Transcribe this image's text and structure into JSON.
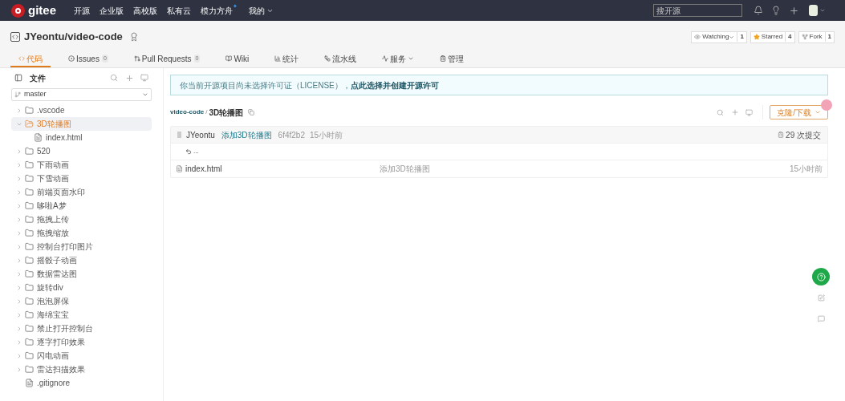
{
  "nav": {
    "logo": "gitee",
    "links": [
      {
        "label": "开源"
      },
      {
        "label": "企业版"
      },
      {
        "label": "高校版"
      },
      {
        "label": "私有云"
      },
      {
        "label": "模力方舟",
        "mark": "✦"
      }
    ],
    "mine": "我的",
    "search": {
      "placeholder": "搜开源"
    }
  },
  "repo": {
    "title": "JYeontu/video-code",
    "actions": [
      {
        "kind": "watch",
        "label": "Watching",
        "count": "1"
      },
      {
        "kind": "star",
        "label": "Starred",
        "count": "4"
      },
      {
        "kind": "fork",
        "label": "Fork",
        "count": "1"
      }
    ]
  },
  "tabs": [
    {
      "kind": "code",
      "label": "代码",
      "selected": true
    },
    {
      "kind": "issues",
      "label": "Issues",
      "count": "0",
      "selected": false
    },
    {
      "kind": "pr",
      "label": "Pull Requests",
      "count": "0",
      "selected": false
    },
    {
      "kind": "wiki",
      "label": "Wiki",
      "selected": false
    },
    {
      "kind": "stats",
      "label": "统计",
      "selected": false
    },
    {
      "kind": "pipeline",
      "label": "流水线",
      "selected": false
    },
    {
      "kind": "service",
      "label": "服务",
      "selected": false
    },
    {
      "kind": "manage",
      "label": "管理",
      "selected": false
    }
  ],
  "sidebar": {
    "title": "文件",
    "branch": "master",
    "tree": [
      {
        "kind": "folder",
        "name": ".vscode",
        "expanded": false,
        "selected": false
      },
      {
        "kind": "folder",
        "name": "3D轮播图",
        "expanded": true,
        "selected": true,
        "children": [
          {
            "kind": "file",
            "name": "index.html",
            "selected": false
          }
        ]
      },
      {
        "kind": "folder",
        "name": "520",
        "expanded": false,
        "selected": false
      },
      {
        "kind": "folder",
        "name": "下雨动画",
        "expanded": false,
        "selected": false
      },
      {
        "kind": "folder",
        "name": "下雪动画",
        "expanded": false,
        "selected": false
      },
      {
        "kind": "folder",
        "name": "前端页面水印",
        "expanded": false,
        "selected": false
      },
      {
        "kind": "folder",
        "name": "哆啦A梦",
        "expanded": false,
        "selected": false
      },
      {
        "kind": "folder",
        "name": "拖拽上传",
        "expanded": false,
        "selected": false
      },
      {
        "kind": "folder",
        "name": "拖拽缩放",
        "expanded": false,
        "selected": false
      },
      {
        "kind": "folder",
        "name": "控制台打印图片",
        "expanded": false,
        "selected": false
      },
      {
        "kind": "folder",
        "name": "摇骰子动画",
        "expanded": false,
        "selected": false
      },
      {
        "kind": "folder",
        "name": "数据雷达图",
        "expanded": false,
        "selected": false
      },
      {
        "kind": "folder",
        "name": "旋转div",
        "expanded": false,
        "selected": false
      },
      {
        "kind": "folder",
        "name": "泡泡屏保",
        "expanded": false,
        "selected": false
      },
      {
        "kind": "folder",
        "name": "海绵宝宝",
        "expanded": false,
        "selected": false
      },
      {
        "kind": "folder",
        "name": "禁止打开控制台",
        "expanded": false,
        "selected": false
      },
      {
        "kind": "folder",
        "name": "逐字打印效果",
        "expanded": false,
        "selected": false
      },
      {
        "kind": "folder",
        "name": "闪电动画",
        "expanded": false,
        "selected": false
      },
      {
        "kind": "folder",
        "name": "雷达扫描效果",
        "expanded": false,
        "selected": false
      },
      {
        "kind": "file",
        "name": ".gitignore",
        "selected": false
      }
    ]
  },
  "notice": {
    "text": "你当前开源项目尚未选择许可证（LICENSE），",
    "link": "点此选择并创建开源许可"
  },
  "breadcrumb": {
    "repo": "video-code",
    "sep": "/",
    "folder": "3D轮播图"
  },
  "clone": "克隆/下载",
  "commit": {
    "author": "JYeontu",
    "message": "添加3D轮播图",
    "hash": "6f4f2b2",
    "time": "15小时前",
    "count": "29 次提交"
  },
  "parent": "...",
  "files": [
    {
      "name": "index.html",
      "message": "添加3D轮播图",
      "time": "15小时前"
    }
  ]
}
